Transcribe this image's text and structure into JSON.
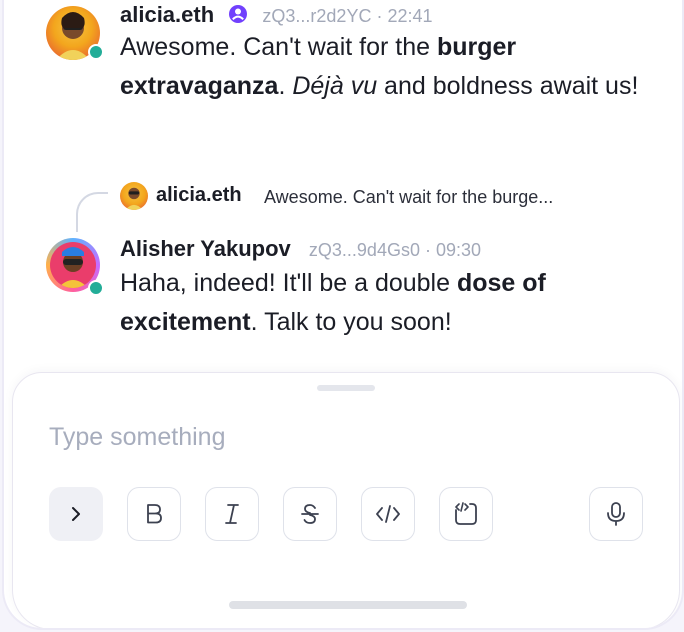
{
  "messages": [
    {
      "username": "alicia.eth",
      "address": "zQ3...r2d2YC",
      "time": "22:41",
      "text_plain_1": "Awesome. Can't wait for the ",
      "text_bold_1": "burger extravaganza",
      "text_plain_2": ". ",
      "text_italic_1": "Déjà vu",
      "text_plain_3": " and boldness await us!",
      "verified_icon": "verified-badge-icon"
    },
    {
      "username": "Alisher Yakupov",
      "address": "zQ3...9d4Gs0",
      "time": "09:30",
      "text_plain_1": "Haha, indeed! It'll be a double ",
      "text_bold_1": "dose of excitement",
      "text_plain_2": ". Talk to you soon!",
      "reply_to": {
        "username": "alicia.eth",
        "text": "Awesome. Can't wait for the burge..."
      }
    }
  ],
  "composer": {
    "placeholder": "Type something",
    "buttons": [
      {
        "name": "expand",
        "icon": "chevron-right-icon"
      },
      {
        "name": "bold",
        "icon": "bold-icon"
      },
      {
        "name": "italic",
        "icon": "italic-icon"
      },
      {
        "name": "strikethrough",
        "icon": "strikethrough-icon"
      },
      {
        "name": "code",
        "icon": "code-icon"
      },
      {
        "name": "code-block",
        "icon": "code-block-icon"
      },
      {
        "name": "microphone",
        "icon": "microphone-icon"
      }
    ]
  },
  "colors": {
    "accent": "#7140fd",
    "online": "#23ad98",
    "meta_text": "#a2a8b8"
  }
}
